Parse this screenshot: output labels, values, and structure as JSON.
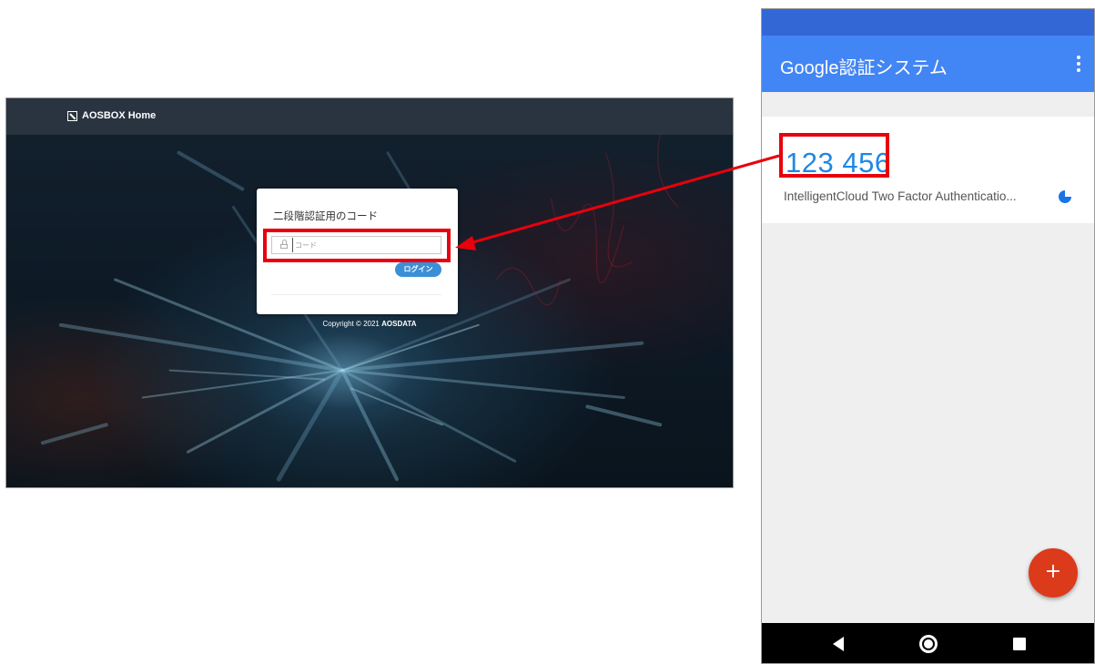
{
  "web": {
    "brand": "AOSBOX Home",
    "card_title": "二段階認証用のコード",
    "code_placeholder": "コード",
    "login_button": "ログイン",
    "copyright_prefix": "Copyright © 2021 ",
    "copyright_company": "AOSDATA"
  },
  "phone": {
    "app_title": "Google認証システム",
    "otp_code": "123 456",
    "account_name": "IntelligentCloud Two Factor Authenticatio...",
    "fab_symbol": "+"
  },
  "colors": {
    "highlight": "#e8000d",
    "app_bar": "#4285f4",
    "status_bar": "#3367d6",
    "otp_code": "#1e88e5",
    "fab": "#db3a1b",
    "login_button": "#3b8fd6"
  },
  "icons": [
    "brand-icon",
    "lock-icon",
    "more-vert-icon",
    "timer-icon",
    "add-icon",
    "back-icon",
    "home-icon",
    "recents-icon"
  ]
}
